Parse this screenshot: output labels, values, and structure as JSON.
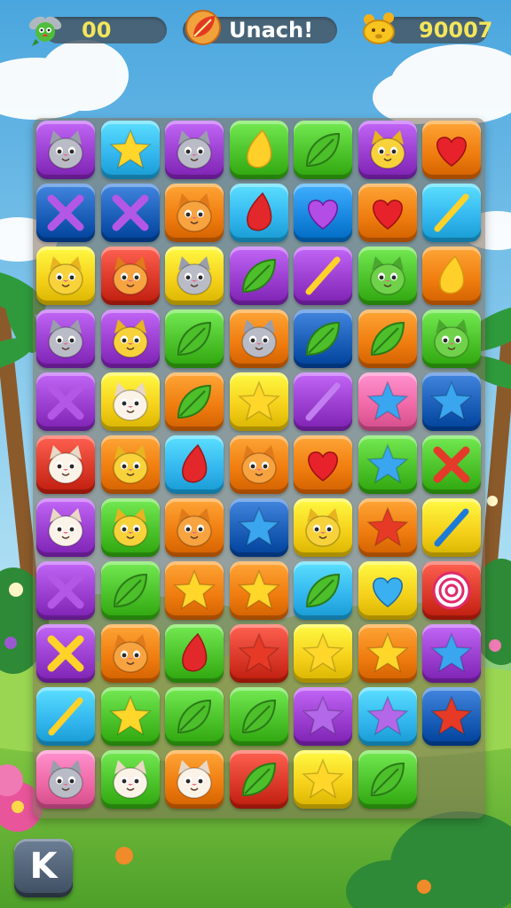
{
  "hud": {
    "moves": "00",
    "player_name": "Unach!",
    "score": "90007",
    "icons": {
      "moves": "fairy-bird-icon",
      "player": "leaf-emblem-icon",
      "score": "trophy-bear-icon"
    }
  },
  "board": {
    "columns": 7,
    "rows": 11,
    "colors": {
      "purple": "#9b3fd0",
      "blue": "#1a88e0",
      "green": "#4cc22b",
      "orange": "#f07e10",
      "red": "#dc3a2a",
      "yellow": "#f6d21c",
      "pink": "#f06aa8",
      "navy": "#1b5fb8",
      "cyan": "#34b8ef"
    },
    "tiles": [
      [
        {
          "c": "purple",
          "i": "cat-gray"
        },
        {
          "c": "cyan",
          "i": "star-yellow"
        },
        {
          "c": "purple",
          "i": "cat-gray"
        },
        {
          "c": "green",
          "i": "drop-yellow"
        },
        {
          "c": "green",
          "i": "leaf"
        },
        {
          "c": "purple",
          "i": "cat-yellow"
        },
        {
          "c": "orange",
          "i": "heart"
        }
      ],
      [
        {
          "c": "navy",
          "i": "x-purple"
        },
        {
          "c": "navy",
          "i": "x-purple"
        },
        {
          "c": "orange",
          "i": "cat-orange"
        },
        {
          "c": "cyan",
          "i": "drop-red"
        },
        {
          "c": "blue",
          "i": "heart-purple"
        },
        {
          "c": "orange",
          "i": "heart"
        },
        {
          "c": "cyan",
          "i": "stick-yellow"
        }
      ],
      [
        {
          "c": "yellow",
          "i": "cat-yellow"
        },
        {
          "c": "red",
          "i": "cat-orange"
        },
        {
          "c": "yellow",
          "i": "cat-gray"
        },
        {
          "c": "purple",
          "i": "leaf"
        },
        {
          "c": "purple",
          "i": "stick-yellow"
        },
        {
          "c": "green",
          "i": "cat-green"
        },
        {
          "c": "orange",
          "i": "drop-yellow"
        }
      ],
      [
        {
          "c": "purple",
          "i": "cat-gray"
        },
        {
          "c": "purple",
          "i": "cat-yellow"
        },
        {
          "c": "green",
          "i": "leaf"
        },
        {
          "c": "orange",
          "i": "cat-gray"
        },
        {
          "c": "navy",
          "i": "leaf"
        },
        {
          "c": "orange",
          "i": "leaf"
        },
        {
          "c": "green",
          "i": "cat-green"
        }
      ],
      [
        {
          "c": "purple",
          "i": "x-purple"
        },
        {
          "c": "yellow",
          "i": "cat-white"
        },
        {
          "c": "orange",
          "i": "leaf"
        },
        {
          "c": "yellow",
          "i": "star-yellow"
        },
        {
          "c": "purple",
          "i": "stick-purple"
        },
        {
          "c": "pink",
          "i": "star-blue"
        },
        {
          "c": "navy",
          "i": "star-blue"
        }
      ],
      [
        {
          "c": "red",
          "i": "cat-white"
        },
        {
          "c": "orange",
          "i": "cat-yellow"
        },
        {
          "c": "cyan",
          "i": "drop-red"
        },
        {
          "c": "orange",
          "i": "cat-orange"
        },
        {
          "c": "orange",
          "i": "heart"
        },
        {
          "c": "green",
          "i": "star-blue"
        },
        {
          "c": "green",
          "i": "x-red"
        }
      ],
      [
        {
          "c": "purple",
          "i": "cat-white"
        },
        {
          "c": "green",
          "i": "cat-yellow"
        },
        {
          "c": "orange",
          "i": "cat-orange"
        },
        {
          "c": "navy",
          "i": "star-blue"
        },
        {
          "c": "yellow",
          "i": "cat-yellow"
        },
        {
          "c": "orange",
          "i": "star-red"
        },
        {
          "c": "yellow",
          "i": "stick-blue"
        }
      ],
      [
        {
          "c": "purple",
          "i": "x-purple"
        },
        {
          "c": "green",
          "i": "leaf"
        },
        {
          "c": "orange",
          "i": "star-yellow"
        },
        {
          "c": "orange",
          "i": "star-yellow"
        },
        {
          "c": "cyan",
          "i": "leaf"
        },
        {
          "c": "yellow",
          "i": "heart-blue"
        },
        {
          "c": "red",
          "i": "target"
        }
      ],
      [
        {
          "c": "purple",
          "i": "x-yellow"
        },
        {
          "c": "orange",
          "i": "cat-orange"
        },
        {
          "c": "green",
          "i": "drop-red"
        },
        {
          "c": "red",
          "i": "star-red"
        },
        {
          "c": "yellow",
          "i": "star-yellow"
        },
        {
          "c": "orange",
          "i": "star-yellow"
        },
        {
          "c": "purple",
          "i": "star-blue"
        }
      ],
      [
        {
          "c": "cyan",
          "i": "stick-yellow"
        },
        {
          "c": "green",
          "i": "star-yellow"
        },
        {
          "c": "green",
          "i": "leaf"
        },
        {
          "c": "green",
          "i": "leaf"
        },
        {
          "c": "purple",
          "i": "star-purple"
        },
        {
          "c": "cyan",
          "i": "star-purple"
        },
        {
          "c": "navy",
          "i": "star-red"
        }
      ],
      [
        {
          "c": "pink",
          "i": "cat-gray"
        },
        {
          "c": "green",
          "i": "cat-white"
        },
        {
          "c": "orange",
          "i": "cat-white"
        },
        {
          "c": "red",
          "i": "leaf"
        },
        {
          "c": "yellow",
          "i": "star-yellow"
        },
        {
          "c": "green",
          "i": "leaf"
        }
      ]
    ]
  },
  "controls": {
    "k_button_label": "K"
  }
}
